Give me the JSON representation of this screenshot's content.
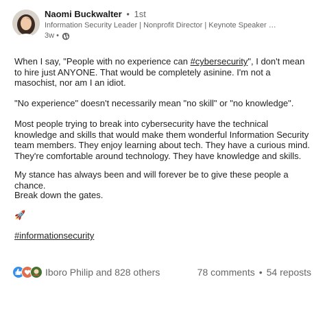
{
  "author": {
    "name": "Naomi Buckwalter",
    "degree": "1st",
    "headline": "Information Security Leader | Nonprofit Director | Keynote Speaker | Link...",
    "time": "3w •"
  },
  "post": {
    "p1_before": "When I say, \"People with no experience can ",
    "p1_hashtag": "#cybersecurity",
    "p1_after": "\", I don't mean to hire just ANYONE. That would be completely asinine. I'm not a masochist, nor am I an idiot.",
    "p2": "\"No experience\" doesn't necessarily mean \"no skill\" or \"no knowledge\".",
    "p3": "Most people trying to break into cybersecurity have the technical knowledge and skills that would make them wonderful Information Security team members. They enjoy learning about tech. They have a curious mind. They're comfortable around technology. They have knowledge and skills.",
    "p4": "My stance has always been and will forever be to give these people a chance.",
    "p5": "Break down the gates.",
    "p6": "🚀",
    "p7_hashtag": "#informationsecurity"
  },
  "social": {
    "reaction_icons": [
      "like-icon",
      "love-icon",
      "support-icon"
    ],
    "reactors": "Iboro Philip and 828 others",
    "comments": "78 comments",
    "separator": "•",
    "reposts": "54 reposts"
  }
}
